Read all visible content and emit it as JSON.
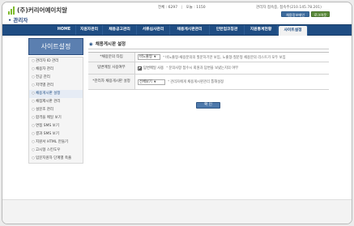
{
  "header": {
    "logo_text": "(주)커리어예이치알",
    "admin_label": "관리자",
    "stats": {
      "visitors_label": "전체",
      "visitors_value": "6297",
      "today_label": "오늘",
      "today_value": "1150"
    },
    "user_info": "관리자 접속중, 접속주(210.145.78.201)",
    "btn_home": "채용정보메인",
    "btn_logout": "로그아웃"
  },
  "nav": {
    "items": [
      "HOME",
      "지원자관리",
      "채용공고관리",
      "서류심사관리",
      "채용게시판관리",
      "인턴업코칭관",
      "지원통계현황",
      "사이트설정"
    ],
    "active_index": 7
  },
  "sidebar": {
    "title": "사이트설정",
    "items": [
      "관리자 ID 관리",
      "채용자 관리",
      "전공 관리",
      "지역별 관리",
      "채용게시판 설정",
      "채점제시판 관리",
      "설문조 관리",
      "합격을 메일 보기",
      "면접 SMS 보기",
      "결과 SMS 보기",
      "지원서 HTML 만들기",
      "고시형 스킨도우",
      "입문지원자 단계별 축출"
    ],
    "active_index": 4
  },
  "main": {
    "title": "채용게시판 설정",
    "rows": [
      {
        "label": "채용분의 타입",
        "select_value": "비노출형",
        "help": "비노출형-채용분의의 질문하기만 보임, 노출형-질문형 채용분의 리스트가 모두 보임"
      },
      {
        "label": "답변메일 사용여부",
        "checkbox_label": "답변메일 사용",
        "help": "문의사항 접수시 회원과 답변을 보냈는지의 여부"
      },
      {
        "label": "관리자 채용게시판 설정",
        "select_value": "전체보기",
        "help": "관리자에게 채용게시판관리 통해설정"
      }
    ],
    "confirm_label": "확 인"
  }
}
